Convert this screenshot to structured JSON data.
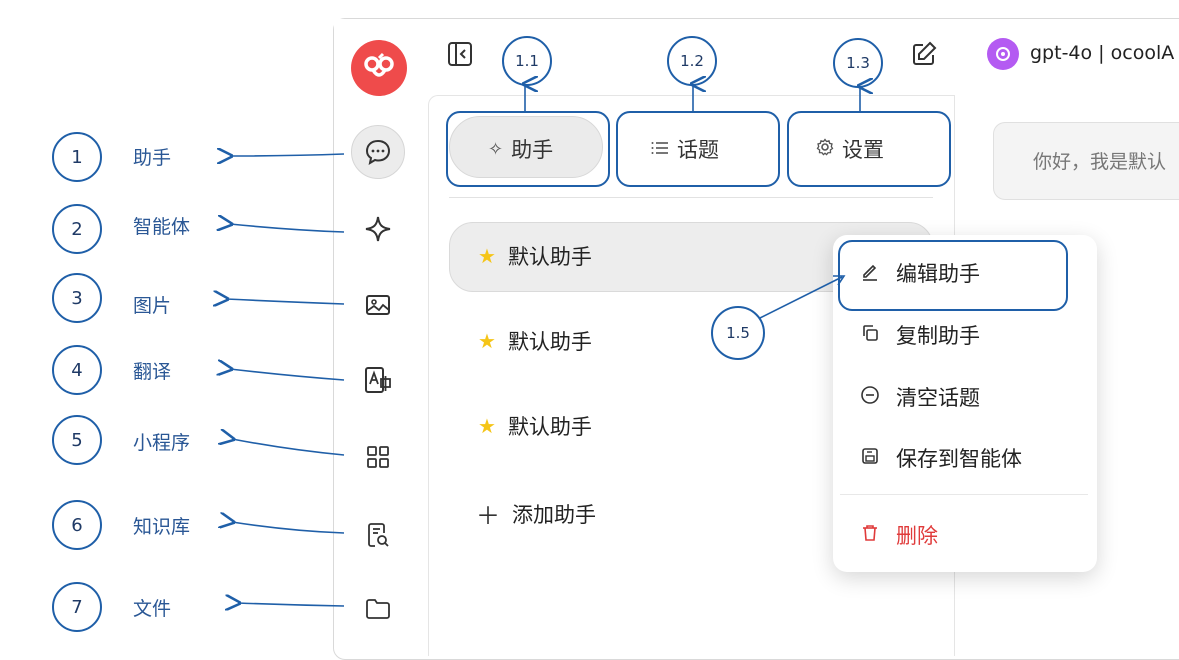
{
  "colors": {
    "brand": "#ef4b4b",
    "annotation": "#1f5fa8",
    "star": "#f5c518",
    "danger": "#e03b3b",
    "model_badge": "#b45bf2"
  },
  "header": {
    "model_label": "gpt-4o | ocoolA",
    "icons": [
      "sidebar-toggle-icon",
      "edit-icon",
      "model-logo-icon"
    ]
  },
  "rail": {
    "items": [
      {
        "name": "chat-icon"
      },
      {
        "name": "sparkle-icon"
      },
      {
        "name": "image-icon"
      },
      {
        "name": "translate-icon"
      },
      {
        "name": "grid-icon"
      },
      {
        "name": "knowledge-search-icon"
      },
      {
        "name": "folder-icon"
      }
    ]
  },
  "tabs": [
    {
      "label": "助手",
      "icon": "sparkle-icon"
    },
    {
      "label": "话题",
      "icon": "list-icon"
    },
    {
      "label": "设置",
      "icon": "gear-icon"
    }
  ],
  "assistants": [
    {
      "label": "默认助手"
    },
    {
      "label": "默认助手"
    },
    {
      "label": "默认助手"
    }
  ],
  "add_assistant": "添加助手",
  "chat_preview": "你好，我是默认",
  "context_menu": {
    "items": [
      {
        "label": "编辑助手",
        "icon": "pencil-icon"
      },
      {
        "label": "复制助手",
        "icon": "copy-icon"
      },
      {
        "label": "清空话题",
        "icon": "minus-circle-icon"
      },
      {
        "label": "保存到智能体",
        "icon": "save-icon"
      }
    ],
    "danger_item": {
      "label": "删除",
      "icon": "trash-icon"
    }
  },
  "annotations": {
    "side_numbers": [
      "1",
      "2",
      "3",
      "4",
      "5",
      "6",
      "7"
    ],
    "side_labels": [
      "助手",
      "智能体",
      "图片",
      "翻译",
      "小程序",
      "知识库",
      "文件"
    ],
    "tab_markers": [
      "1.1",
      "1.2",
      "1.3"
    ],
    "menu_marker": "1.5"
  }
}
